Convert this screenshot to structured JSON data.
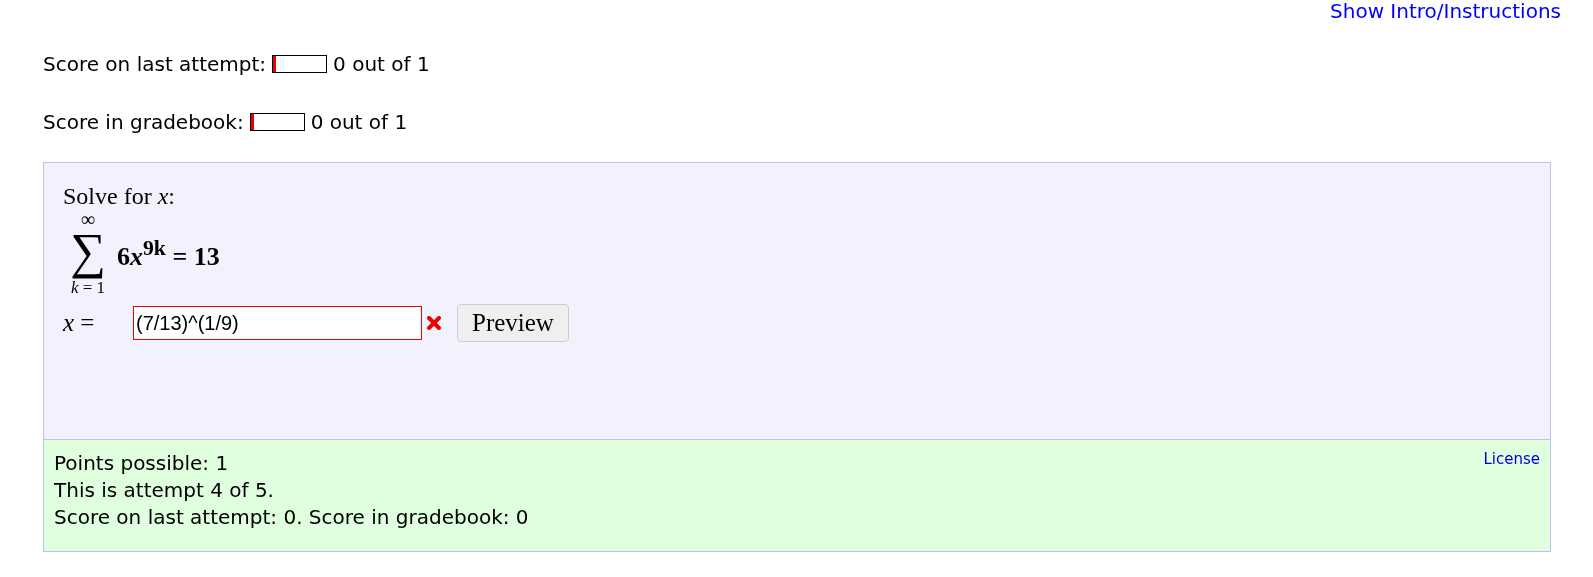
{
  "intro_link": "Show Intro/Instructions",
  "scores": [
    {
      "label": "Score on last attempt:",
      "level": 0,
      "reading": "0 out of 1"
    },
    {
      "label": "Score in gradebook:",
      "level": 0,
      "reading": "0 out of 1"
    }
  ],
  "question": {
    "prompt": "Solve for *x*:",
    "sum_upper": "∞",
    "sum_symbol": "∑",
    "sum_lower": "*k* = 1",
    "term_coefficient": "6",
    "term_variable": "x",
    "term_exponent": "9k",
    "term_rest": "= 13",
    "answer_label": "*x* =",
    "answer_value": "(7/13)^(1/9)",
    "answer_correct": false,
    "preview_button": "Preview"
  },
  "footer": {
    "lines": [
      "Points possible: 1",
      "This is attempt 4 of 5.",
      "Score on last attempt: 0. Score in gradebook: 0"
    ],
    "license_link": "License"
  }
}
